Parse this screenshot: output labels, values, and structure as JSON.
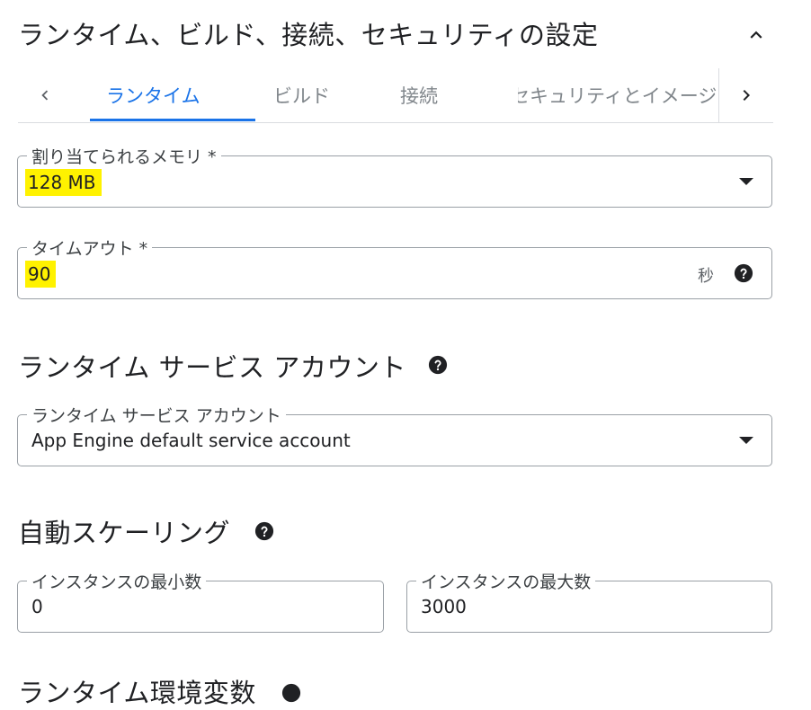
{
  "section": {
    "title": "ランタイム、ビルド、接続、セキュリティの設定"
  },
  "tabs": [
    {
      "label": "ランタイム",
      "active": true
    },
    {
      "label": "ビルド"
    },
    {
      "label": "接続"
    },
    {
      "label": "セキュリティとイメージ"
    }
  ],
  "memory": {
    "label": "割り当てられるメモリ *",
    "value": "128 MB"
  },
  "timeout": {
    "label": "タイムアウト *",
    "value": "90",
    "suffix": "秒"
  },
  "service_account": {
    "heading": "ランタイム サービス アカウント",
    "label": "ランタイム サービス アカウント",
    "value": "App Engine default service account"
  },
  "autoscaling": {
    "heading": "自動スケーリング",
    "min": {
      "label": "インスタンスの最小数",
      "value": "0"
    },
    "max": {
      "label": "インスタンスの最大数",
      "value": "3000"
    }
  },
  "env_vars": {
    "heading": "ランタイム環境変数"
  },
  "colors": {
    "accent": "#1a73e8",
    "highlight": "#fff200",
    "border": "#9aa0a6"
  }
}
